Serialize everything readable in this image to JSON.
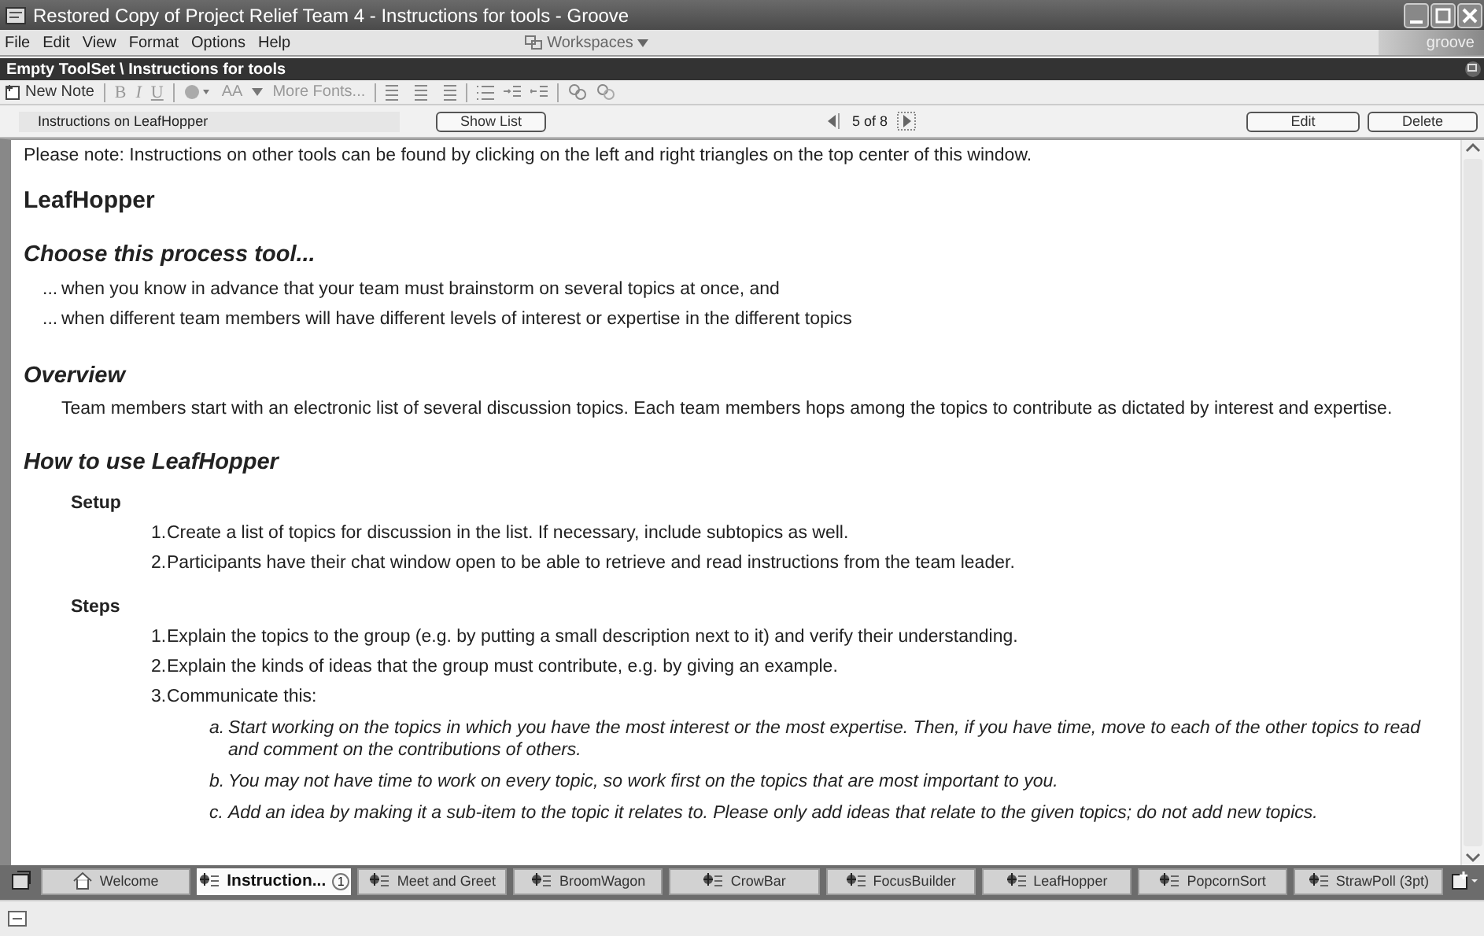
{
  "window": {
    "title": "Restored Copy of Project Relief Team 4 - Instructions for tools - Groove"
  },
  "menu": [
    "File",
    "Edit",
    "View",
    "Format",
    "Options",
    "Help"
  ],
  "workspaces": "Workspaces",
  "brand": "groove",
  "tool_header": "Empty ToolSet \\ Instructions for tools",
  "toolbar": {
    "new_note": "New Note",
    "bold": "B",
    "italic": "I",
    "underline": "U",
    "font_size": "AA",
    "more_fonts": "More Fonts..."
  },
  "nav": {
    "note_title": "Instructions on LeafHopper",
    "show_list": "Show List",
    "position": "5 of 8",
    "edit": "Edit",
    "delete": "Delete"
  },
  "document": {
    "note": "Please note: Instructions on other tools can be found by clicking on the left and right triangles on the top center of this window.",
    "title": "LeafHopper",
    "sections": [
      {
        "kind": "bullets",
        "heading": "Choose this process tool...",
        "items": [
          {
            "marker": "...",
            "text": "when you know in advance that your team must brainstorm on several topics at once, and"
          },
          {
            "marker": "...",
            "text": "when different team members will have different levels of interest or expertise in the different topics"
          }
        ]
      },
      {
        "kind": "paragraph",
        "heading": "Overview",
        "text": "Team members start with an electronic list of several discussion topics.   Each team members hops among the topics to contribute as dictated by interest and expertise."
      },
      {
        "kind": "howto",
        "heading": "How to use LeafHopper",
        "subsections": [
          {
            "heading": "Setup",
            "steps": [
              {
                "marker": "1.",
                "text": "Create a list of topics for discussion in the list. If necessary, include subtopics as well."
              },
              {
                "marker": "2.",
                "text": "Participants have their chat window open to be able to retrieve and read instructions from the team leader."
              }
            ]
          },
          {
            "heading": "Steps",
            "steps": [
              {
                "marker": "1.",
                "text": "Explain the topics to the group (e.g. by putting a small description next to it) and verify their understanding."
              },
              {
                "marker": "2.",
                "text": "Explain the kinds of ideas that the group must contribute, e.g. by giving an example."
              },
              {
                "marker": "3.",
                "text": "Communicate this:",
                "substeps": [
                  {
                    "marker": "a.",
                    "text": "Start working on the topics in which you have the most interest or the most expertise. Then, if you have time, move to each of the other topics to read and comment on the contributions of others."
                  },
                  {
                    "marker": "b.",
                    "text": "You may not have time to work on every topic, so work  first on the topics that are most important to you."
                  },
                  {
                    "marker": "c.",
                    "text": "Add an idea by making it a sub-item to the topic it relates to. Please only add ideas that relate to the given topics; do not add new topics."
                  }
                ]
              }
            ]
          }
        ]
      }
    ]
  },
  "tabs": [
    {
      "label": "Welcome",
      "kind": "home",
      "selected": false
    },
    {
      "label": "Instruction...",
      "kind": "tool",
      "selected": true,
      "badge": "1"
    },
    {
      "label": "Meet and Greet",
      "kind": "tool",
      "selected": false
    },
    {
      "label": "BroomWagon",
      "kind": "tool",
      "selected": false
    },
    {
      "label": "CrowBar",
      "kind": "tool",
      "selected": false
    },
    {
      "label": "FocusBuilder",
      "kind": "tool",
      "selected": false
    },
    {
      "label": "LeafHopper",
      "kind": "tool",
      "selected": false
    },
    {
      "label": "PopcornSort",
      "kind": "tool",
      "selected": false
    },
    {
      "label": "StrawPoll (3pt)",
      "kind": "tool",
      "selected": false
    }
  ]
}
